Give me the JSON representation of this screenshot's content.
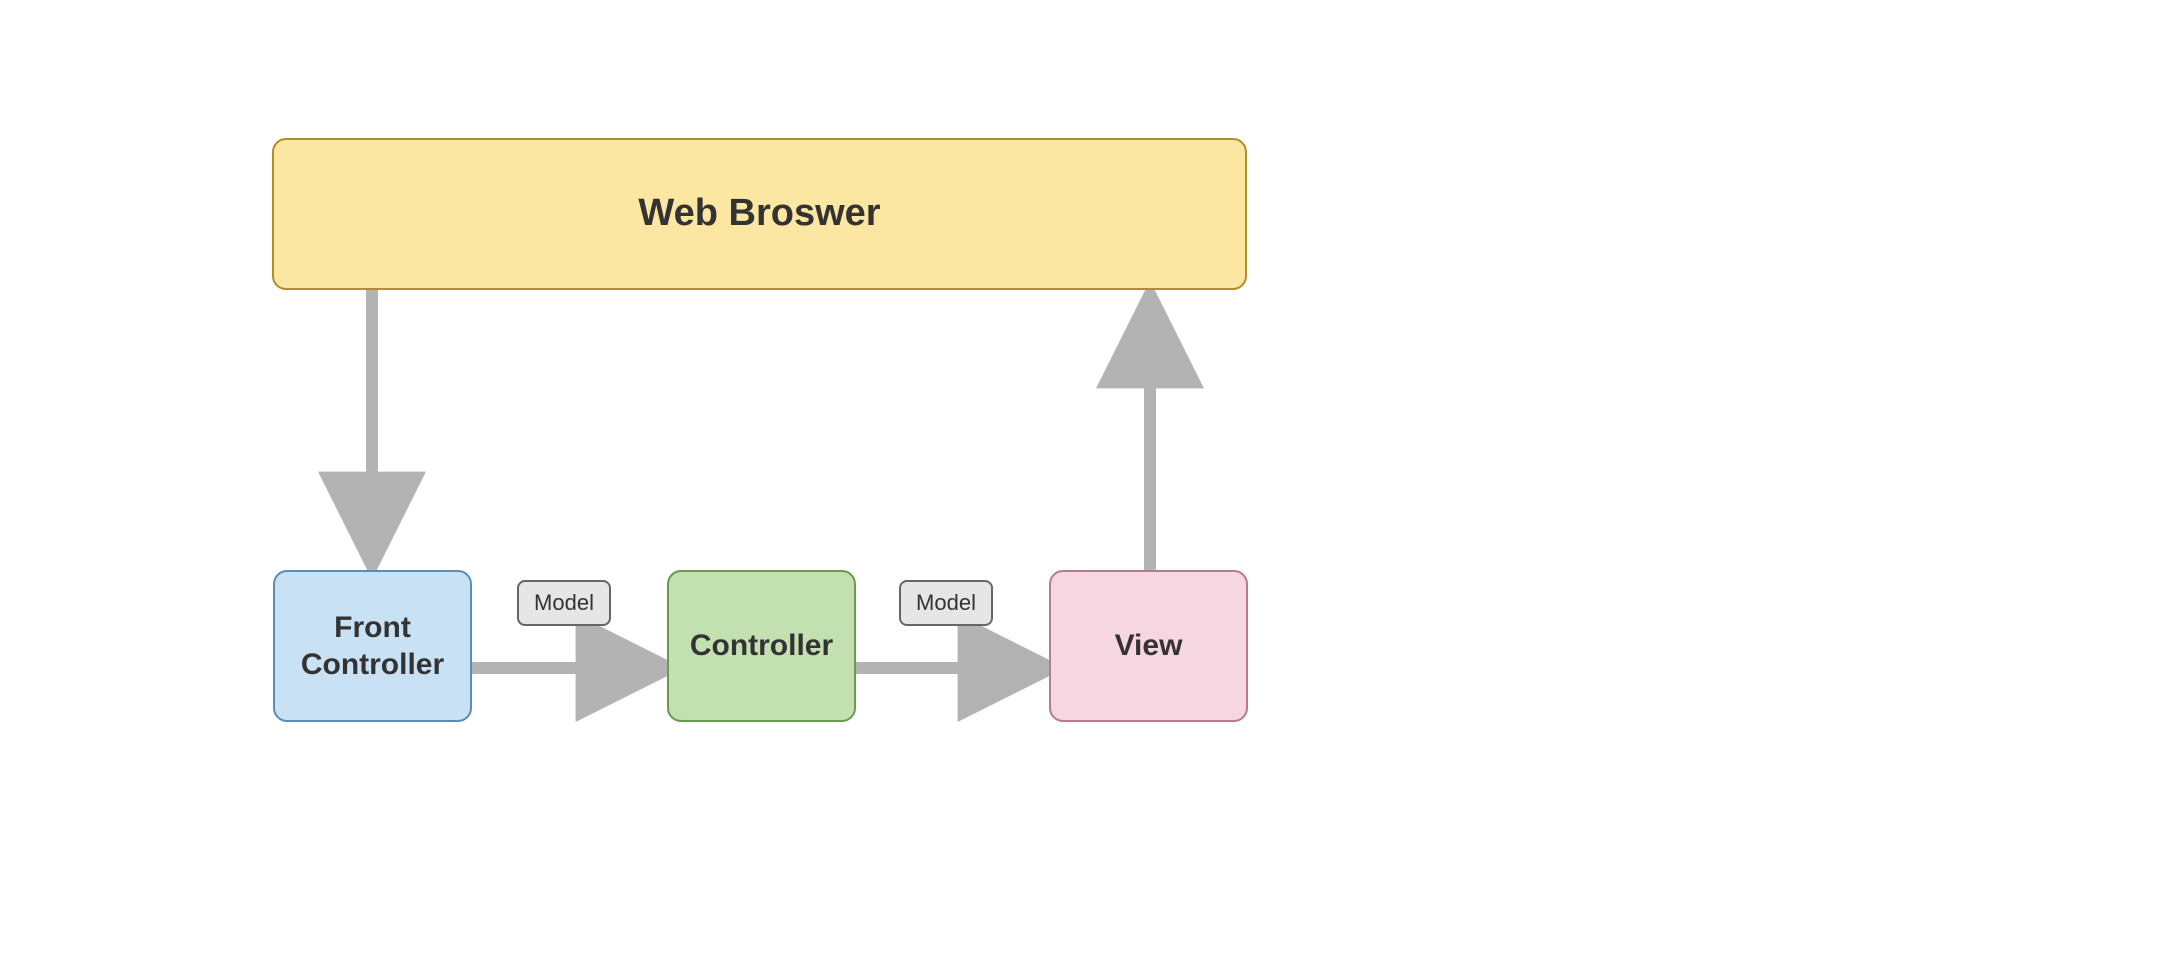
{
  "nodes": {
    "web_browser": {
      "label": "Web Broswer"
    },
    "front_controller": {
      "label_line1": "Front",
      "label_line2": "Controller"
    },
    "controller": {
      "label": "Controller"
    },
    "view": {
      "label": "View"
    }
  },
  "edge_labels": {
    "model1": "Model",
    "model2": "Model"
  },
  "colors": {
    "yellow_fill": "#fbe6a2",
    "yellow_stroke": "#b08f2a",
    "blue_fill": "#c9e1f5",
    "blue_stroke": "#5a8db8",
    "green_fill": "#c3e1b0",
    "green_stroke": "#6a9a4e",
    "pink_fill": "#f6d6e0",
    "pink_stroke": "#b87a8f",
    "arrow": "#b3b3b3"
  }
}
